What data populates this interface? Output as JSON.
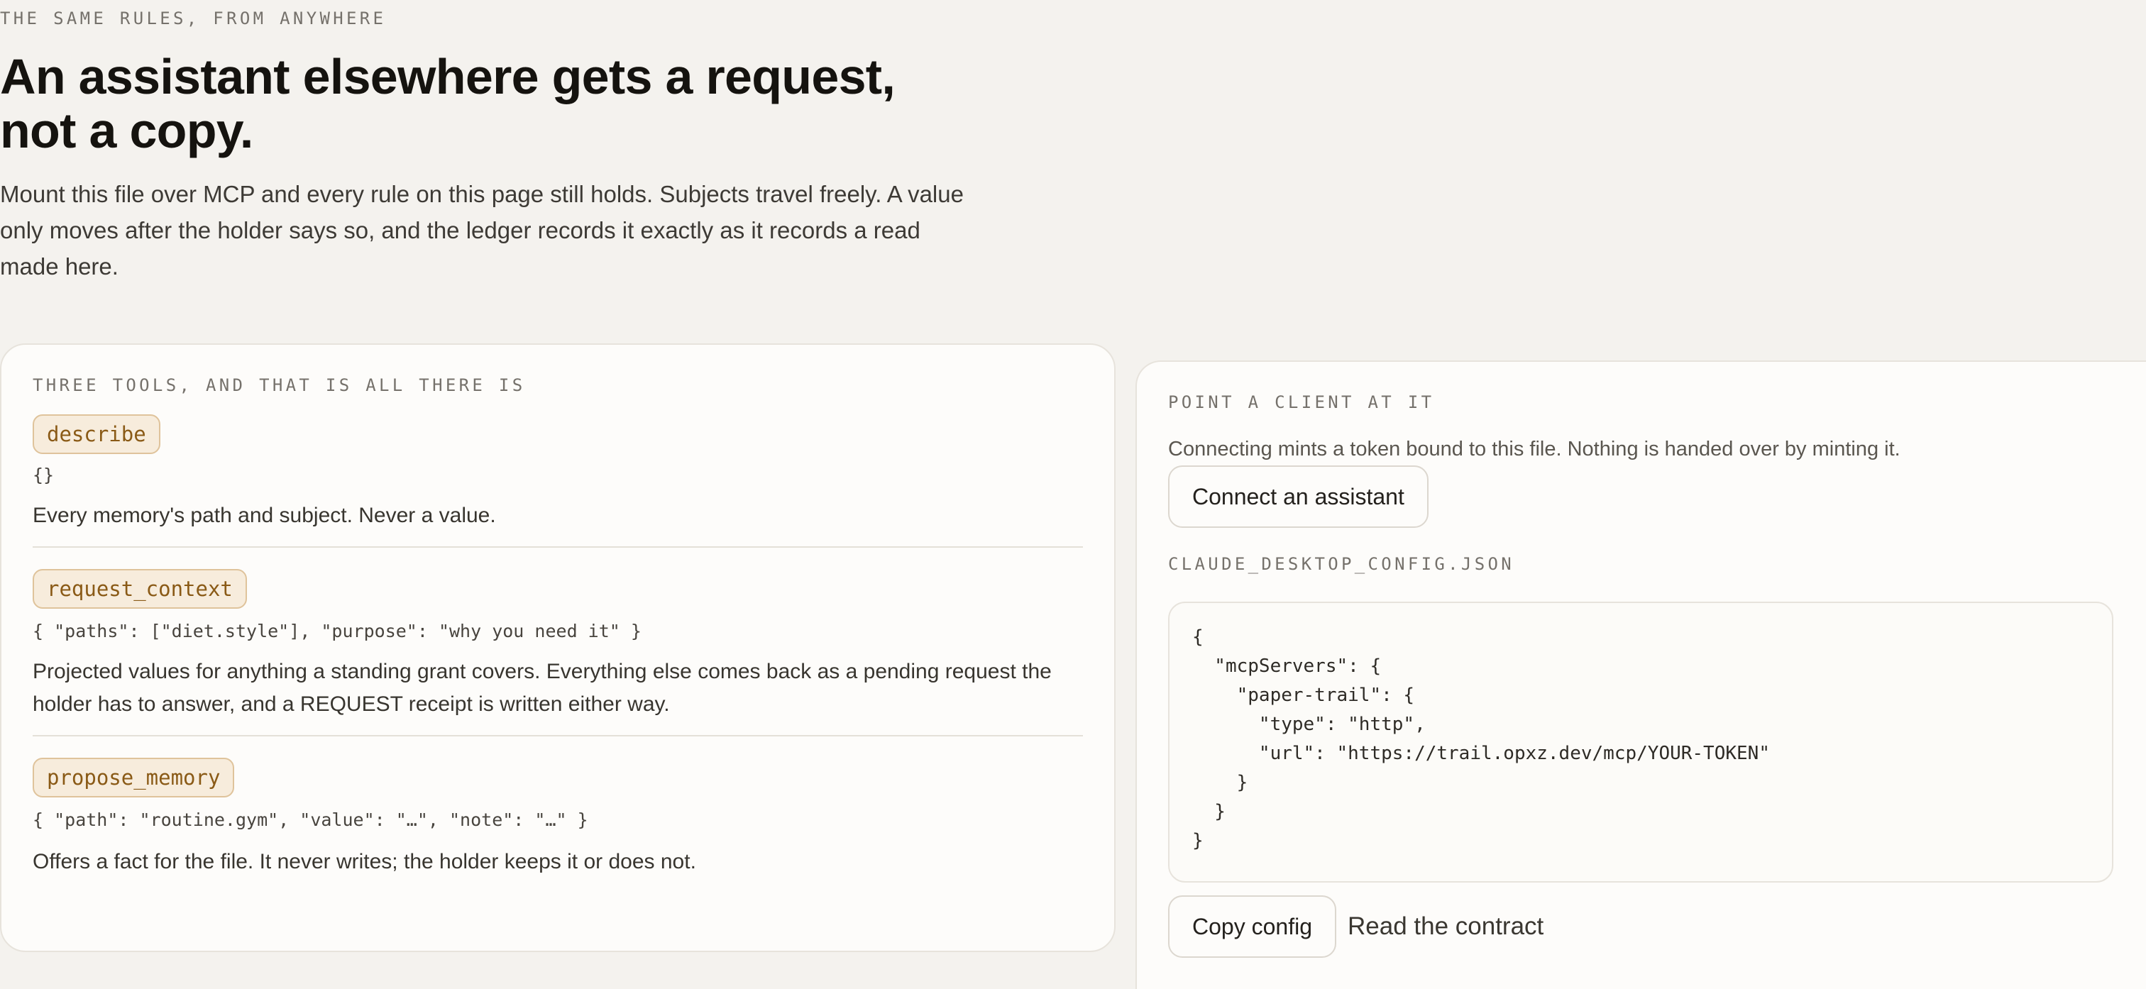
{
  "header": {
    "eyebrow": "THE SAME RULES, FROM ANYWHERE",
    "headline": "An assistant elsewhere gets a request, not a copy.",
    "intro": "Mount this file over MCP and every rule on this page still holds. Subjects travel freely. A value only moves after the holder says so, and the ledger records it exactly as it records a read made here."
  },
  "tools_card": {
    "eyebrow": "THREE TOOLS, AND THAT IS ALL THERE IS",
    "tools": [
      {
        "name": "describe",
        "signature": "{}",
        "description": "Every memory's path and subject. Never a value."
      },
      {
        "name": "request_context",
        "signature": "{ \"paths\": [\"diet.style\"], \"purpose\": \"why you need it\" }",
        "description": "Projected values for anything a standing grant covers. Everything else comes back as a pending request the holder has to answer, and a REQUEST receipt is written either way."
      },
      {
        "name": "propose_memory",
        "signature": "{ \"path\": \"routine.gym\", \"value\": \"…\", \"note\": \"…\" }",
        "description": "Offers a fact for the file. It never writes; the holder keeps it or does not."
      }
    ]
  },
  "client_card": {
    "eyebrow": "POINT A CLIENT AT IT",
    "subtitle": "Connecting mints a token bound to this file. Nothing is handed over by minting it.",
    "connect_button": "Connect an assistant",
    "config_label": "CLAUDE_DESKTOP_CONFIG.JSON",
    "config_code": "{\n  \"mcpServers\": {\n    \"paper-trail\": {\n      \"type\": \"http\",\n      \"url\": \"https://trail.opxz.dev/mcp/YOUR-TOKEN\"\n    }\n  }\n}",
    "copy_button": "Copy config",
    "contract_link": "Read the contract"
  }
}
